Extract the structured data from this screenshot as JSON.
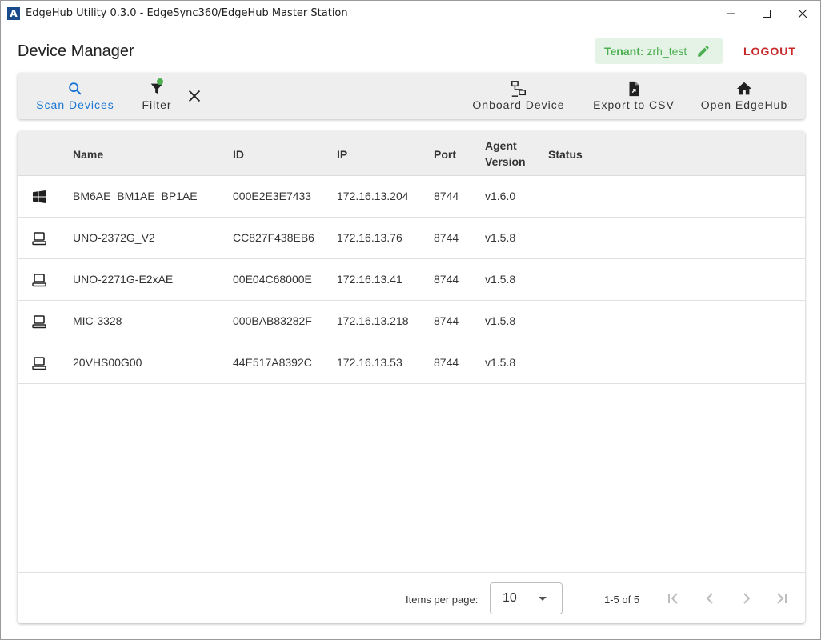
{
  "window": {
    "logo_letter": "A",
    "title": "EdgeHub Utility 0.3.0 - EdgeSync360/EdgeHub Master Station"
  },
  "header": {
    "page_title": "Device Manager",
    "tenant_label": "Tenant:",
    "tenant_value": "zrh_test",
    "logout_label": "LOGOUT"
  },
  "toolbar": {
    "scan_label": "Scan Devices",
    "filter_label": "Filter",
    "onboard_label": "Onboard Device",
    "export_label": "Export to CSV",
    "open_label": "Open EdgeHub"
  },
  "table": {
    "headers": {
      "name": "Name",
      "id": "ID",
      "ip": "IP",
      "port": "Port",
      "version_line1": "Agent",
      "version_line2": "Version",
      "status": "Status"
    },
    "rows": [
      {
        "os_icon": "windows-icon",
        "name": "BM6AE_BM1AE_BP1AE",
        "id": "000E2E3E7433",
        "ip": "172.16.13.204",
        "port": "8744",
        "version": "v1.6.0",
        "status": ""
      },
      {
        "os_icon": "linux-device-icon",
        "name": "UNO-2372G_V2",
        "id": "CC827F438EB6",
        "ip": "172.16.13.76",
        "port": "8744",
        "version": "v1.5.8",
        "status": ""
      },
      {
        "os_icon": "linux-device-icon",
        "name": "UNO-2271G-E2xAE",
        "id": "00E04C68000E",
        "ip": "172.16.13.41",
        "port": "8744",
        "version": "v1.5.8",
        "status": ""
      },
      {
        "os_icon": "linux-device-icon",
        "name": "MIC-3328",
        "id": "000BAB83282F",
        "ip": "172.16.13.218",
        "port": "8744",
        "version": "v1.5.8",
        "status": ""
      },
      {
        "os_icon": "linux-device-icon",
        "name": "20VHS00G00",
        "id": "44E517A8392C",
        "ip": "172.16.13.53",
        "port": "8744",
        "version": "v1.5.8",
        "status": ""
      }
    ]
  },
  "pagination": {
    "items_per_page_label": "Items per page:",
    "items_per_page_value": "10",
    "range_label": "1-5 of 5"
  },
  "colors": {
    "accent": "#1976d2",
    "tenant_green": "#4caf50",
    "logout_red": "#c62828",
    "toolbar_bg": "#eeeeee"
  }
}
